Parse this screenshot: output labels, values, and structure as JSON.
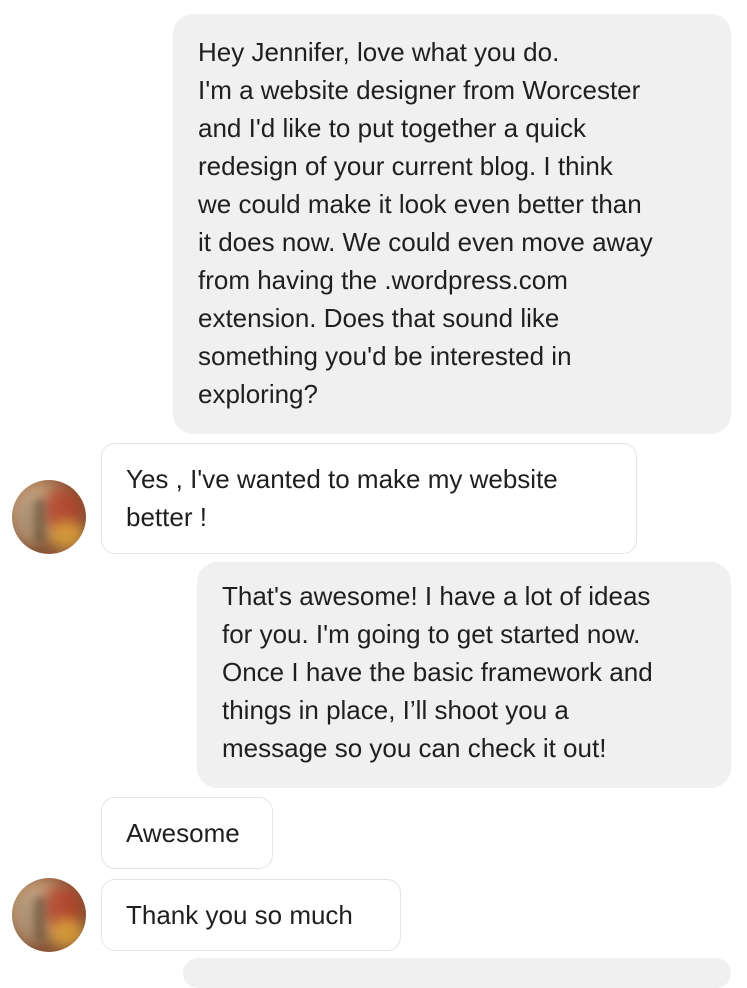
{
  "conversation": {
    "messages": [
      {
        "sender": "me",
        "lines": [
          "Hey Jennifer, love what you do.",
          "I'm a website designer from Worcester",
          "and I'd like to put together a quick",
          "redesign of your current blog. I think",
          "we could make it look even better than",
          "it does now. We could even move away",
          "from having the .wordpress.com",
          "extension. Does that sound like",
          "something you'd be interested in",
          "exploring?"
        ]
      },
      {
        "sender": "them",
        "lines": [
          "Yes , I've wanted to make my website",
          "better !"
        ]
      },
      {
        "sender": "me",
        "lines": [
          "That's awesome! I have a lot of ideas",
          "for you. I'm going to get started now.",
          "Once I have the basic framework and",
          "things in place, I’ll shoot you a",
          "message so you can check it out!"
        ]
      },
      {
        "sender": "them",
        "lines": [
          "Awesome"
        ]
      },
      {
        "sender": "them",
        "lines": [
          "Thank you so much"
        ]
      }
    ]
  },
  "colors": {
    "outgoing_bubble": "#f0f0f0",
    "incoming_bubble": "#ffffff",
    "incoming_border": "#e4e4e4",
    "text": "#1f1f1f"
  }
}
